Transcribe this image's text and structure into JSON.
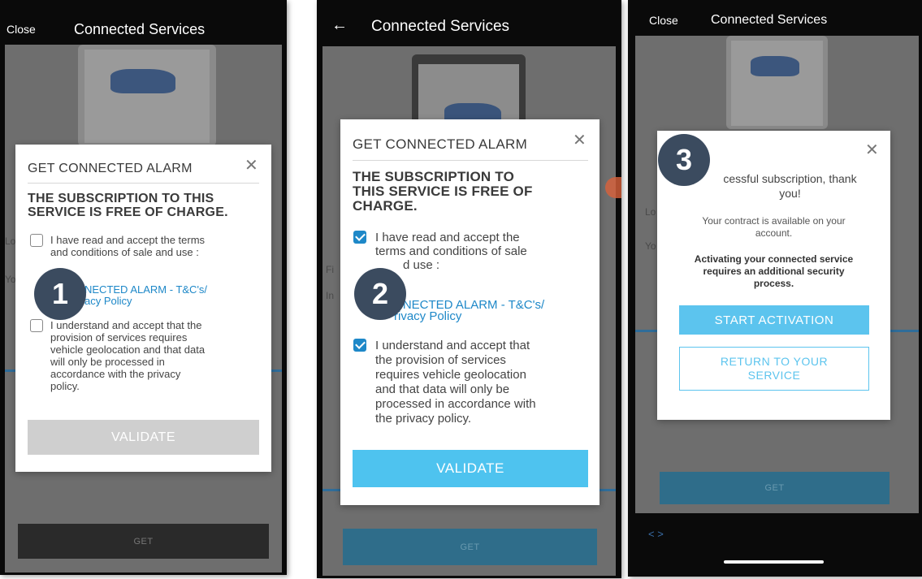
{
  "common": {
    "title": "Connected Services",
    "close_label": "Close",
    "get_label": "GET",
    "accent_color": "#4ec3ef",
    "badge_color": "#3b4b5f"
  },
  "screen1": {
    "step": "1",
    "modal_title": "GET CONNECTED ALARM",
    "heading_line1": "THE SUBSCRIPTION TO THIS",
    "heading_line2": "SERVICE IS FREE OF CHARGE.",
    "terms_line1": "I have read and accept the terms",
    "terms_line2": "and conditions of sale and use :",
    "link_line1": "NECTED ALARM - T&C's/",
    "link_line2": "acy Policy",
    "geo_line1": "I understand and accept that the",
    "geo_line2": "provision of services requires",
    "geo_line3": "vehicle geolocation and that data",
    "geo_line4": "will only be processed in",
    "geo_line5": "accordance with the privacy",
    "geo_line6": "policy.",
    "terms_checked": false,
    "geo_checked": false,
    "validate_label": "VALIDATE",
    "validate_enabled": false
  },
  "screen2": {
    "step": "2",
    "modal_title": "GET CONNECTED ALARM",
    "heading_line1": "THE SUBSCRIPTION TO",
    "heading_line2": "THIS SERVICE IS FREE OF",
    "heading_line3": "CHARGE.",
    "terms_line1": "I have read and accept the",
    "terms_line2": "terms and conditions of sale",
    "terms_line3": "d use :",
    "link_line1": "NNECTED ALARM - T&C's/",
    "link_line2": "rivacy Policy",
    "geo_line1": "I understand and accept that",
    "geo_line2": "the provision of services",
    "geo_line3": "requires vehicle geolocation",
    "geo_line4": "and that data will only be",
    "geo_line5": "processed in accordance with",
    "geo_line6": "the privacy policy.",
    "terms_checked": true,
    "geo_checked": true,
    "validate_label": "VALIDATE",
    "validate_enabled": true
  },
  "screen3": {
    "step": "3",
    "success_line1": "cessful subscription, thank",
    "success_line2": "you!",
    "contract_line1": "Your contract is available on your",
    "contract_line2": "account.",
    "notice_line1": "Activating your connected service",
    "notice_line2": "requires an additional security",
    "notice_line3": "process.",
    "start_label": "START ACTIVATION",
    "return_line1": "RETURN TO YOUR",
    "return_line2": "SERVICE",
    "pager": "< >"
  }
}
